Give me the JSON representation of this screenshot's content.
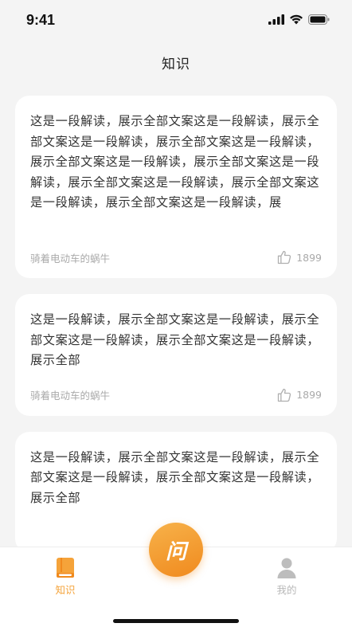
{
  "status_bar": {
    "time": "9:41"
  },
  "nav": {
    "title": "知识"
  },
  "cards": [
    {
      "text": "这是一段解读，展示全部文案这是一段解读，展示全部文案这是一段解读，展示全部文案这是一段解读，展示全部文案这是一段解读，展示全部文案这是一段解读，展示全部文案这是一段解读，展示全部文案这是一段解读，展示全部文案这是一段解读，展",
      "author": "骑着电动车的蜗牛",
      "likes": "1899"
    },
    {
      "text": "这是一段解读，展示全部文案这是一段解读，展示全部文案这是一段解读，展示全部文案这是一段解读，展示全部",
      "author": "骑着电动车的蜗牛",
      "likes": "1899"
    },
    {
      "text": "这是一段解读，展示全部文案这是一段解读，展示全部文案这是一段解读，展示全部文案这是一段解读，展示全部",
      "author": "",
      "likes": ""
    }
  ],
  "tab_bar": {
    "knowledge_label": "知识",
    "ask_label": "问",
    "mine_label": "我的"
  },
  "colors": {
    "accent": "#f5a33a",
    "inactive": "#b8b8b8",
    "background": "#f4f4f4"
  }
}
